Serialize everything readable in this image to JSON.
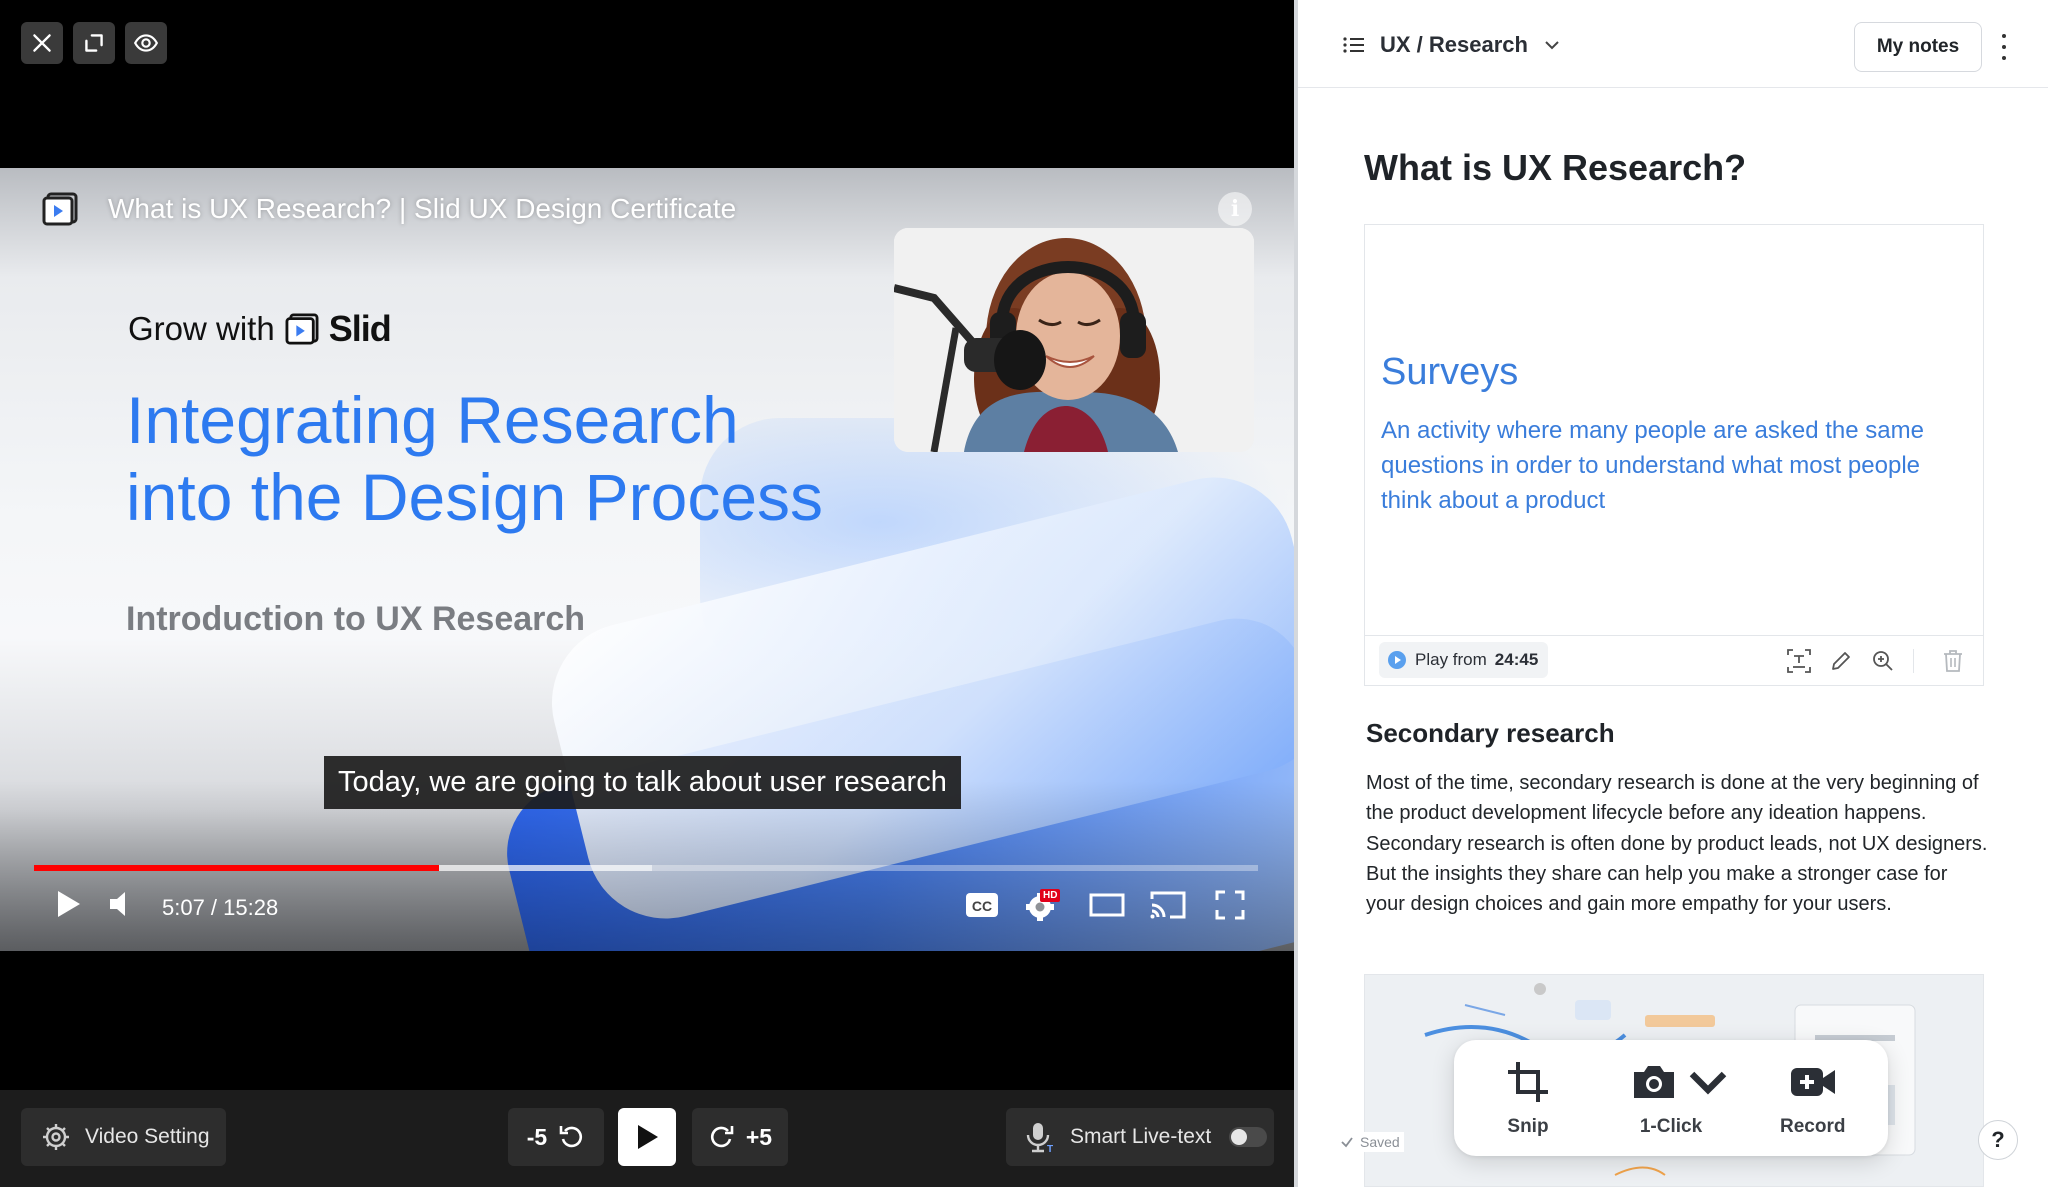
{
  "top_controls": {
    "close_icon": "close-icon",
    "collapse_icon": "exit-fullscreen-icon",
    "view_icon": "eye-icon"
  },
  "video": {
    "youtube_title": "What is UX Research? | Slid UX Design Certificate",
    "slide": {
      "grow_text": "Grow with",
      "brand": "Slid",
      "headline_line1": "Integrating Research",
      "headline_line2": "into the Design Process",
      "subheading": "Introduction to UX Research"
    },
    "caption": "Today, we are going to talk about user research",
    "time_display": "5:07 / 15:28",
    "progress_fraction": 0.3307,
    "buffered_fraction": 0.505,
    "hd_badge": "HD",
    "accent_color": "#ff0000"
  },
  "bottom_bar": {
    "video_setting_label": "Video Setting",
    "rewind_label": "-5",
    "forward_label": "+5",
    "smart_live_text_label": "Smart Live-text",
    "smart_live_text_enabled": false
  },
  "notes": {
    "breadcrumb": "UX / Research",
    "my_notes_label": "My notes",
    "doc_title": "What is UX Research?",
    "snip": {
      "slide_heading": "Surveys",
      "slide_body": "An activity where many people are asked the same questions in order to understand what most people think about a product",
      "play_from_label": "Play from",
      "play_from_time": "24:45",
      "accent_color": "#3a7ddb"
    },
    "section_heading": "Secondary research",
    "section_body": "Most of the time, secondary research is done at the very beginning of the product development lifecycle before any ideation happens. Secondary research is often done by product leads, not UX designers. But the insights they share can help you make a stronger case for your design choices and gain more empathy for your users.",
    "saved_label": "Saved",
    "capture": {
      "snip_label": "Snip",
      "one_click_label": "1-Click",
      "record_label": "Record"
    },
    "help_label": "?"
  }
}
